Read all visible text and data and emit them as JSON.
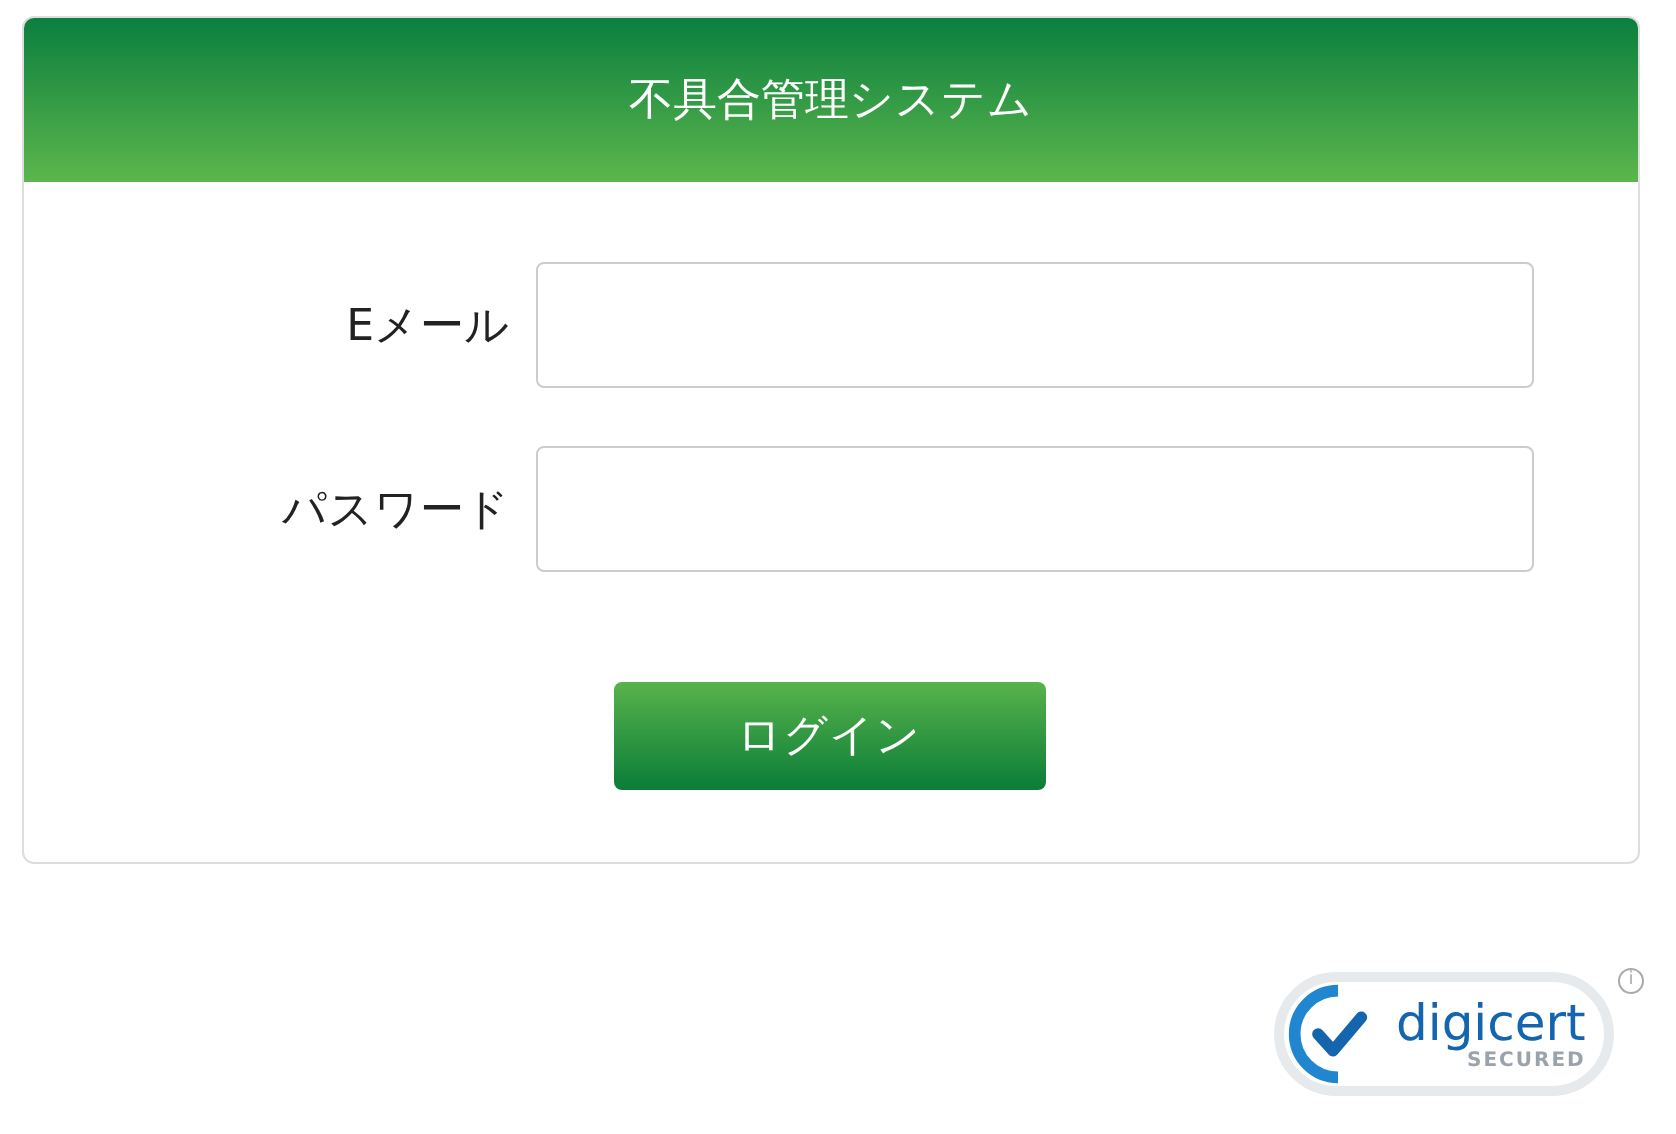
{
  "header": {
    "title": "不具合管理システム"
  },
  "fields": [
    {
      "label": "Eメール"
    },
    {
      "label": "パスワード"
    }
  ],
  "login_button": {
    "label": "ログイン"
  },
  "security_badge": {
    "brand": "digicert",
    "caption": "SECURED",
    "info": "i"
  }
}
